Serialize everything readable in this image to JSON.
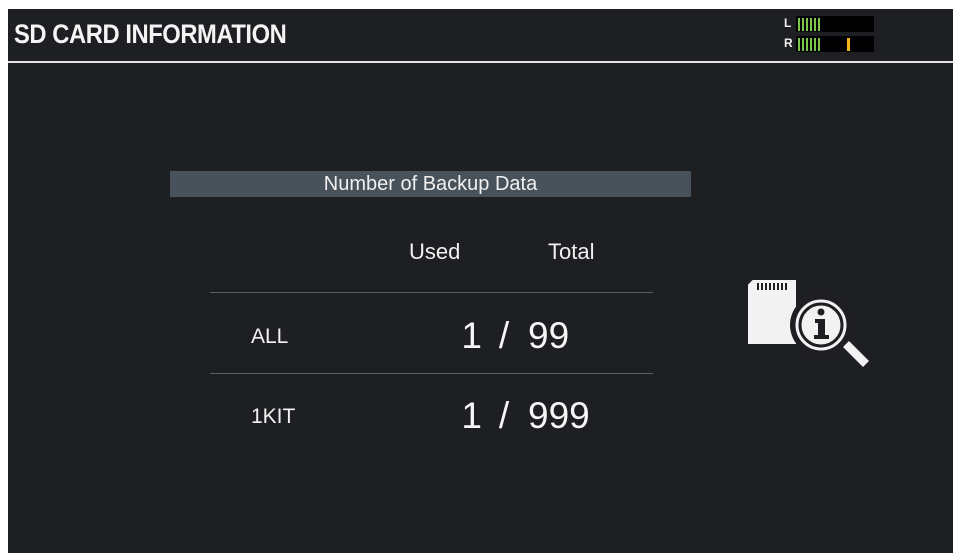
{
  "header": {
    "title": "SD CARD INFORMATION",
    "meter": {
      "left_label": "L",
      "right_label": "R",
      "left_level": 0.35,
      "right_level": 0.35,
      "right_peak_level": 0.66,
      "level_color": "#7cc74a",
      "peak_color": "#f3b31c"
    }
  },
  "panel": {
    "heading": "Number of Backup Data",
    "columns": {
      "used": "Used",
      "total": "Total"
    },
    "rows": [
      {
        "label": "ALL",
        "used": "1",
        "separator": "/",
        "total": "99"
      },
      {
        "label": "1KIT",
        "used": "1",
        "separator": "/",
        "total": "999"
      }
    ]
  },
  "icons": {
    "info": "sd-card-info-icon"
  },
  "colors": {
    "background": "#1e1f22",
    "panel_bar": "#48525a",
    "text": "#f2f2f2"
  }
}
